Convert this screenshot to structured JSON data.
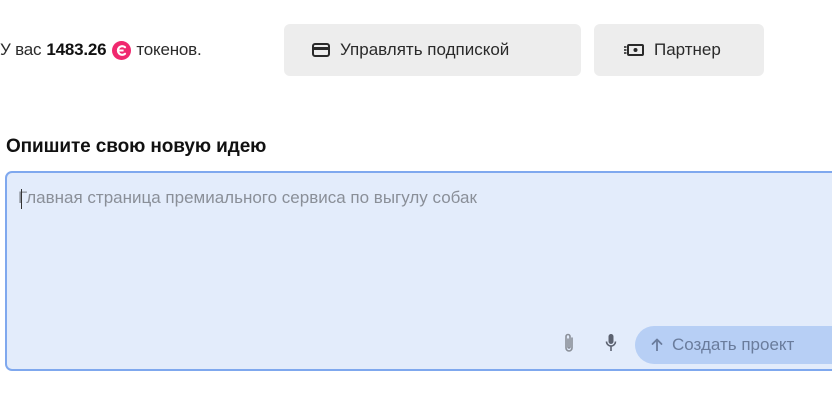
{
  "balance": {
    "prefix": "У вас",
    "amount": "1483.26",
    "suffix": "токенов.",
    "coin_icon": "token-coin-icon",
    "coin_color": "#f0286e"
  },
  "toolbar": {
    "subscription_label": "Управлять подпиской",
    "subscription_icon": "credit-card-icon",
    "partner_label": "Партнер",
    "partner_icon": "banknote-icon"
  },
  "idea": {
    "heading": "Опишите свою новую идею",
    "placeholder": "Главная страница премиального сервиса по выгулу собак",
    "value": "",
    "attach_icon": "paperclip-icon",
    "mic_icon": "microphone-icon",
    "create_label": "Создать проект",
    "create_icon": "arrow-up-icon"
  },
  "colors": {
    "box_background": "#e3ecfb",
    "box_border": "#7fa8ee",
    "create_button": "#b7cff5",
    "secondary_button": "#ededed"
  }
}
